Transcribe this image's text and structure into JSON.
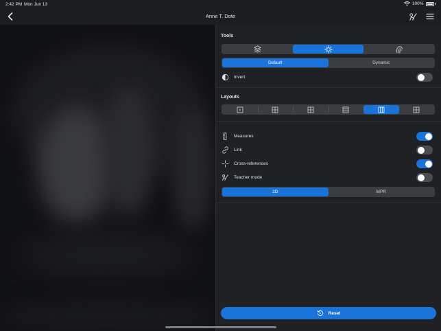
{
  "status_bar": {
    "time": "2:42 PM",
    "date": "Mon Jun 13",
    "battery": "100%"
  },
  "nav": {
    "title": "Anne T. Dote"
  },
  "tools": {
    "title": "Tools",
    "tool_icons": [
      "layers-icon",
      "brightness-icon",
      "touch-gesture-icon"
    ],
    "active_tool_index": 1,
    "modes": [
      "Default",
      "Dynamic"
    ],
    "active_mode_index": 0,
    "invert": {
      "label": "Invert",
      "on": false
    }
  },
  "layouts": {
    "title": "Layouts",
    "options": [
      "single-layout-icon",
      "grid-2x2-icon",
      "grid-2x2-icon",
      "rows-layout-icon",
      "columns-layout-icon",
      "grid-layout-icon"
    ],
    "active_index": 4
  },
  "settings": [
    {
      "label": "Measures",
      "icon": "ruler-icon",
      "on": true
    },
    {
      "label": "Link",
      "icon": "link-icon",
      "on": false
    },
    {
      "label": "Cross-references",
      "icon": "crosshair-icon",
      "on": true
    },
    {
      "label": "Teacher mode",
      "icon": "teacher-icon",
      "on": false
    }
  ],
  "view_mode": {
    "options": [
      "2D",
      "MPR"
    ],
    "active_index": 0
  },
  "reset": {
    "label": "Reset"
  },
  "colors": {
    "accent": "#1a73d9",
    "panel": "#1f2125",
    "segment": "#3a3d42"
  }
}
